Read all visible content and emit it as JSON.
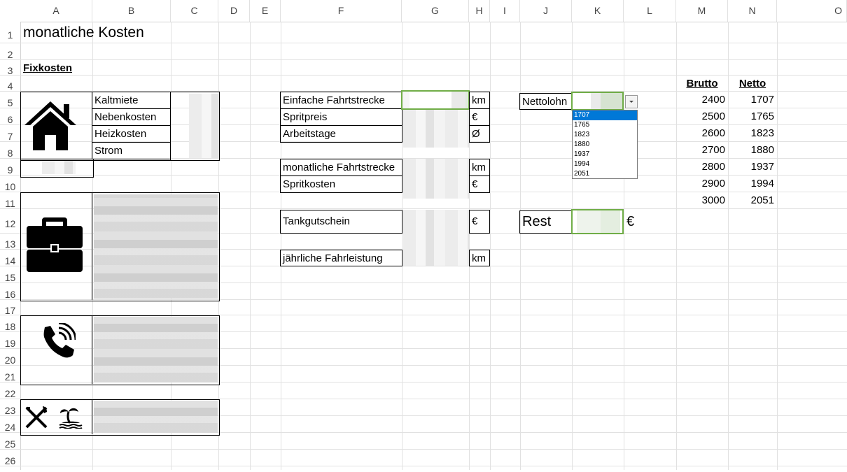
{
  "columns": [
    "A",
    "B",
    "C",
    "D",
    "E",
    "F",
    "G",
    "H",
    "I",
    "J",
    "K",
    "L",
    "M",
    "N",
    "O"
  ],
  "rows": [
    "1",
    "2",
    "3",
    "4",
    "5",
    "6",
    "7",
    "8",
    "9",
    "10",
    "11",
    "12",
    "13",
    "14",
    "15",
    "16",
    "17",
    "18",
    "19",
    "20",
    "21",
    "22",
    "23",
    "24",
    "25",
    "26"
  ],
  "sheet": {
    "title": "monatliche Kosten",
    "fixkosten_label": "Fixkosten",
    "housing_items": [
      "Kaltmiete",
      "Nebenkosten",
      "Heizkosten",
      "Strom"
    ],
    "commute": {
      "one_way_label": "Einfache Fahrtstrecke",
      "one_way_unit": "km",
      "fuel_price_label": "Spritpreis",
      "fuel_price_unit": "€",
      "workdays_label": "Arbeitstage",
      "workdays_unit": "Ø",
      "monthly_distance_label": "monatliche Fahrtstrecke",
      "monthly_distance_unit": "km",
      "fuel_cost_label": "Spritkosten",
      "fuel_cost_unit": "€",
      "fuel_voucher_label": "Tankgutschein",
      "fuel_voucher_unit": "€",
      "annual_mileage_label": "jährliche Fahrleistung",
      "annual_mileage_unit": "km"
    },
    "net_wage_label": "Nettolohn",
    "rest_label": "Rest",
    "rest_unit": "€",
    "dropdown_options": [
      "1707",
      "1765",
      "1823",
      "1880",
      "1937",
      "1994",
      "2051"
    ],
    "dropdown_selected": "1707",
    "salary_table": {
      "headers": [
        "Brutto",
        "Netto"
      ],
      "rows": [
        [
          "2400",
          "1707"
        ],
        [
          "2500",
          "1765"
        ],
        [
          "2600",
          "1823"
        ],
        [
          "2700",
          "1880"
        ],
        [
          "2800",
          "1937"
        ],
        [
          "2900",
          "1994"
        ],
        [
          "3000",
          "2051"
        ]
      ]
    }
  },
  "icons": [
    "house-icon",
    "briefcase-icon",
    "phone-icon",
    "fork-knife-icon",
    "island-icon",
    "dropdown-arrow-icon"
  ]
}
